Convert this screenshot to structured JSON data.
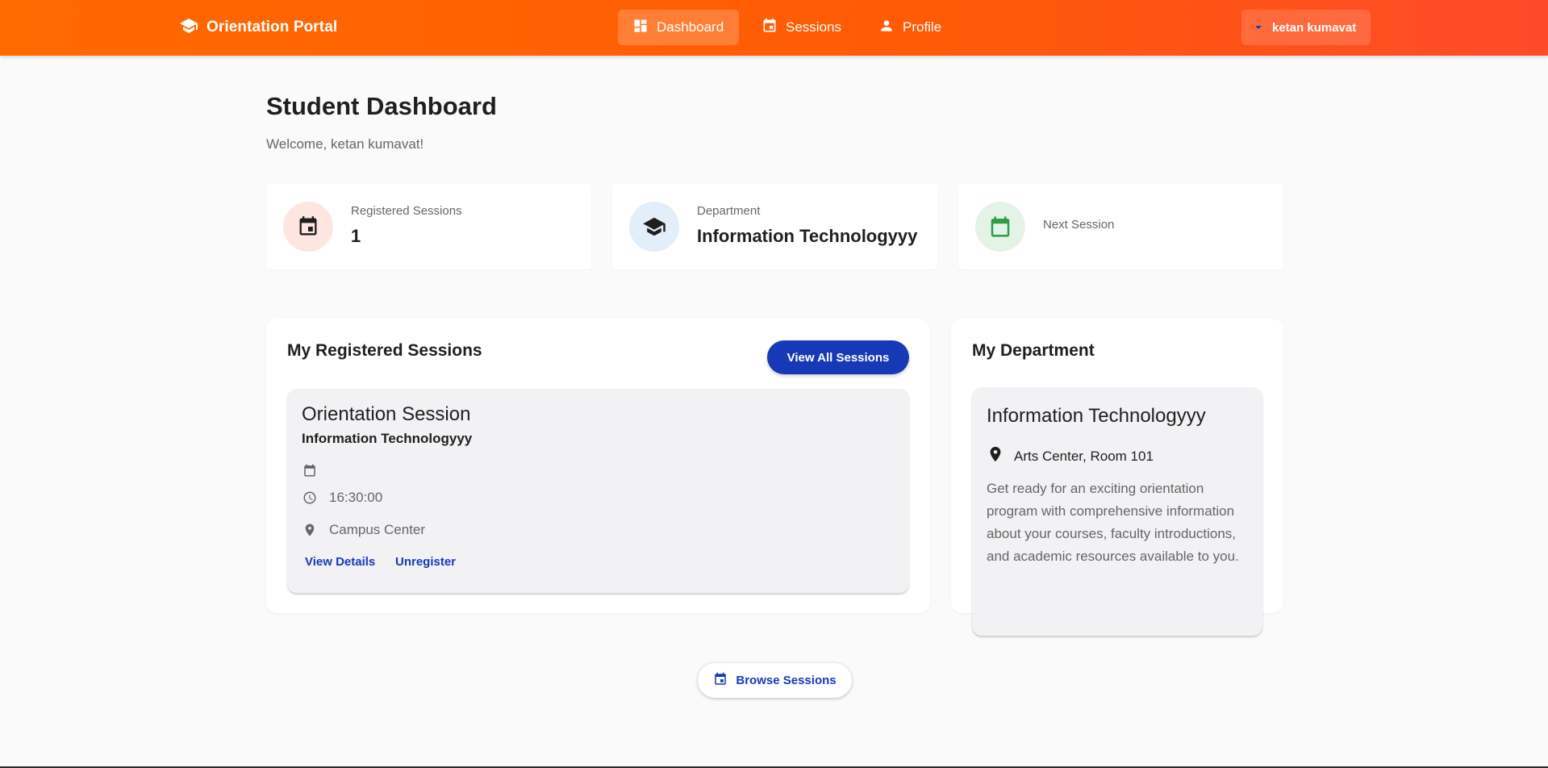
{
  "brand": {
    "name": "Orientation Portal",
    "icon": "graduation-cap-icon"
  },
  "nav": [
    {
      "label": "Dashboard",
      "icon": "dashboard-icon",
      "active": true
    },
    {
      "label": "Sessions",
      "icon": "calendar-icon",
      "active": false
    },
    {
      "label": "Profile",
      "icon": "person-icon",
      "active": false
    }
  ],
  "user": {
    "name": "ketan kumavat",
    "icon": "chevron-down-icon"
  },
  "header": {
    "title": "Student Dashboard",
    "welcome": "Welcome, ketan kumavat!"
  },
  "stats": [
    {
      "label": "Registered Sessions",
      "value": "1",
      "icon": "calendar-icon",
      "color": "#fde6df"
    },
    {
      "label": "Department",
      "value": "Information Technologyyy",
      "icon": "graduation-cap-icon",
      "color": "#e3eefb"
    },
    {
      "label": "Next Session",
      "value": "",
      "icon": "calendar-icon",
      "color": "#e3f3e6"
    }
  ],
  "registered": {
    "title": "My Registered Sessions",
    "view_all": "View All Sessions",
    "session": {
      "title": "Orientation Session",
      "department": "Information Technologyyy",
      "date": "",
      "time": "16:30:00",
      "location": "Campus Center",
      "view_details": "View Details",
      "unregister": "Unregister"
    }
  },
  "department": {
    "title": "My Department",
    "name": "Information Technologyyy",
    "location": "Arts Center, Room 101",
    "description": "Get ready for an exciting orientation program with comprehensive information about your courses, faculty introductions, and academic resources available to you."
  },
  "browse": {
    "label": "Browse Sessions",
    "icon": "calendar-icon"
  },
  "colors": {
    "accent": "#ff6a00",
    "primary": "#1739b8"
  }
}
